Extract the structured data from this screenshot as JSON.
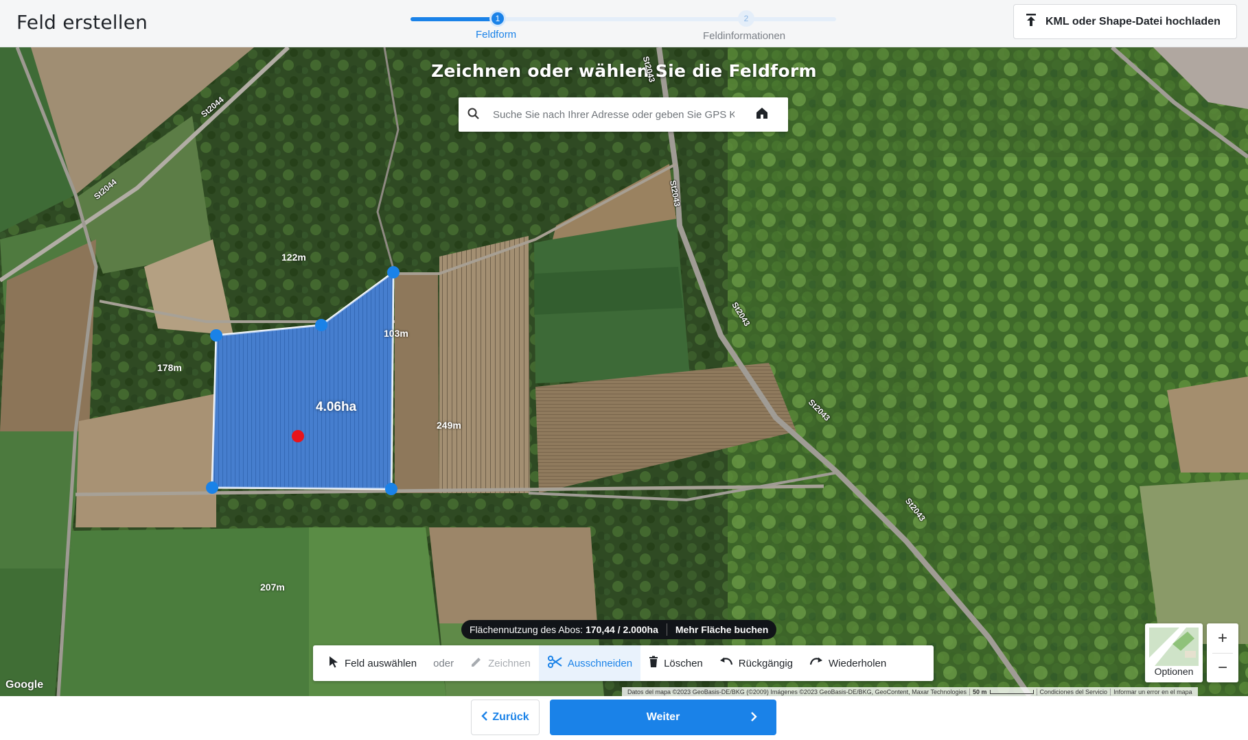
{
  "header": {
    "title": "Feld erstellen",
    "steps": [
      {
        "number": "1",
        "label": "Feldform"
      },
      {
        "number": "2",
        "label": "Feldinformationen"
      }
    ],
    "upload_label": "KML oder Shape-Datei hochladen"
  },
  "map": {
    "heading": "Zeichnen oder wählen Sie die Feldform",
    "search_placeholder": "Suche Sie nach Ihrer Adresse oder geben Sie GPS Koordinaten ein",
    "area": "4.06ha",
    "distances": [
      "122m",
      "103m",
      "178m",
      "249m",
      "207m"
    ],
    "roads": [
      "St2044",
      "St2044",
      "St2043",
      "St2043",
      "St2043",
      "St2043",
      "St2043"
    ],
    "usage": {
      "label": "Flächennutzung des Abos:",
      "value": "170,44 / 2.000ha",
      "buy_label": "Mehr Fläche buchen"
    },
    "toolbar": {
      "select": "Feld auswählen",
      "or": "oder",
      "draw": "Zeichnen",
      "cut": "Ausschneiden",
      "delete": "Löschen",
      "undo": "Rückgängig",
      "redo": "Wiederholen"
    },
    "options_label": "Optionen",
    "zoom_in": "+",
    "zoom_out": "−",
    "google": "Google",
    "attribution": {
      "data": "Datos del mapa ©2023 GeoBasis-DE/BKG (©2009) Imágenes ©2023 GeoBasis-DE/BKG, GeoContent, Maxar Technologies",
      "scale": "50 m",
      "terms": "Condiciones del Servicio",
      "report": "Informar un error en el mapa"
    }
  },
  "footer": {
    "back_label": "Zurück",
    "next_label": "Weiter"
  },
  "colors": {
    "accent": "#1a82e8",
    "polygon_fill": "#3f7fd6",
    "vertex": "#1a82e8",
    "center": "#e8141b"
  }
}
